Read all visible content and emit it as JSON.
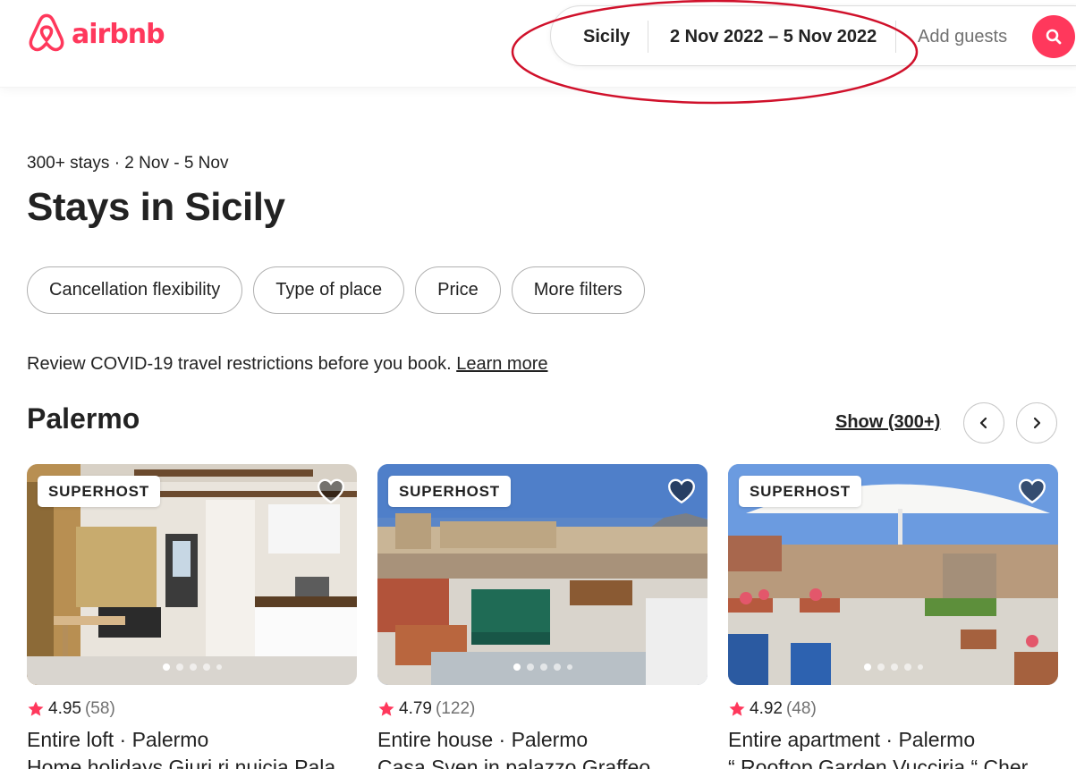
{
  "header": {
    "logo_text": "airbnb",
    "search": {
      "location": "Sicily",
      "dates": "2 Nov 2022 – 5 Nov 2022",
      "guests_placeholder": "Add guests"
    }
  },
  "results": {
    "subtitle": "300+ stays · 2 Nov - 5 Nov",
    "title": "Stays in Sicily"
  },
  "filters": [
    "Cancellation flexibility",
    "Type of place",
    "Price",
    "More filters"
  ],
  "covid": {
    "text": "Review COVID-19 travel restrictions before you book.",
    "link": "Learn more"
  },
  "section": {
    "title": "Palermo",
    "show_all": "Show (300+)"
  },
  "listings": [
    {
      "badge": "SUPERHOST",
      "rating": "4.95",
      "reviews": "(58)",
      "type": "Entire loft · Palermo",
      "name": "Home holidays Giuri ri nuicia Pala"
    },
    {
      "badge": "SUPERHOST",
      "rating": "4.79",
      "reviews": "(122)",
      "type": "Entire house · Palermo",
      "name": "Casa Sven in palazzo Graffeo"
    },
    {
      "badge": "SUPERHOST",
      "rating": "4.92",
      "reviews": "(48)",
      "type": "Entire apartment · Palermo",
      "name": "“ Rooftop Garden Vucciria “ Cher"
    }
  ],
  "colors": {
    "brand": "#FF385C",
    "annotation": "#D0112B",
    "text": "#222222",
    "muted": "#717171"
  }
}
